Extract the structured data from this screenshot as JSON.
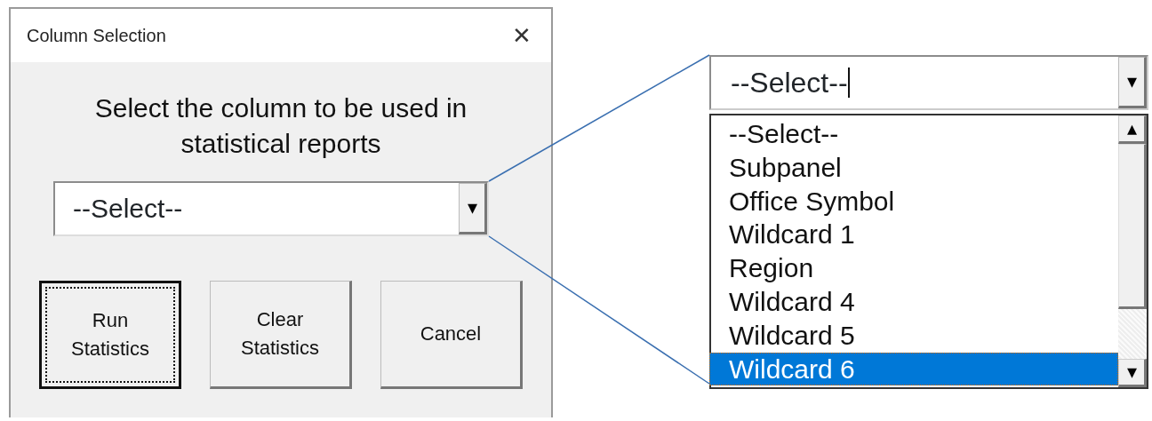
{
  "window": {
    "title": "Column Selection",
    "close": "✕"
  },
  "prompt": "Select the column to be used in statistical reports",
  "combo": {
    "value": "--Select--",
    "arrow": "▾"
  },
  "buttons": [
    {
      "label": "Run\nStatistics",
      "focused": true
    },
    {
      "label": "Clear\nStatistics",
      "focused": false
    },
    {
      "label": "Cancel",
      "focused": false
    }
  ],
  "zoom_combo": {
    "value": "--Select--",
    "caret": true,
    "arrow": "▾"
  },
  "dropdown": {
    "items": [
      {
        "label": "--Select--",
        "selected": false
      },
      {
        "label": "Subpanel",
        "selected": false
      },
      {
        "label": "Office Symbol",
        "selected": false
      },
      {
        "label": "Wildcard 1",
        "selected": false
      },
      {
        "label": "Region",
        "selected": false
      },
      {
        "label": "Wildcard 4",
        "selected": false
      },
      {
        "label": "Wildcard 5",
        "selected": false
      },
      {
        "label": "Wildcard 6",
        "selected": true
      }
    ],
    "scroll_up": "▴",
    "scroll_down": "▾"
  }
}
